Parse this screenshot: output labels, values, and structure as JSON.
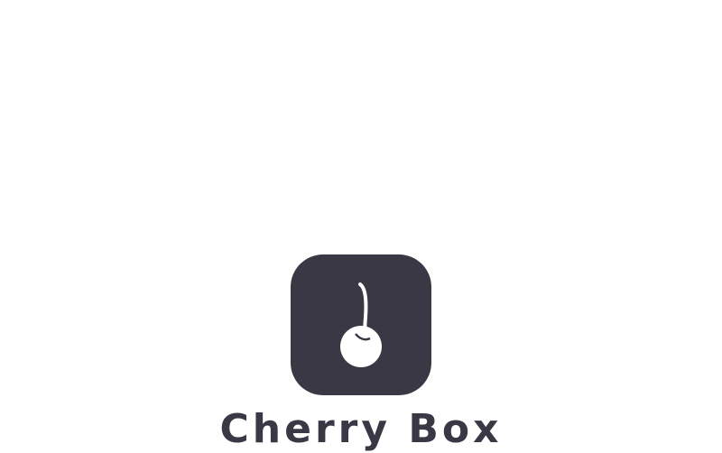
{
  "app": {
    "name": "Cherry Box",
    "logo_icon": "cherry-icon",
    "colors": {
      "brand": "#3a3845",
      "background": "#ffffff"
    }
  }
}
